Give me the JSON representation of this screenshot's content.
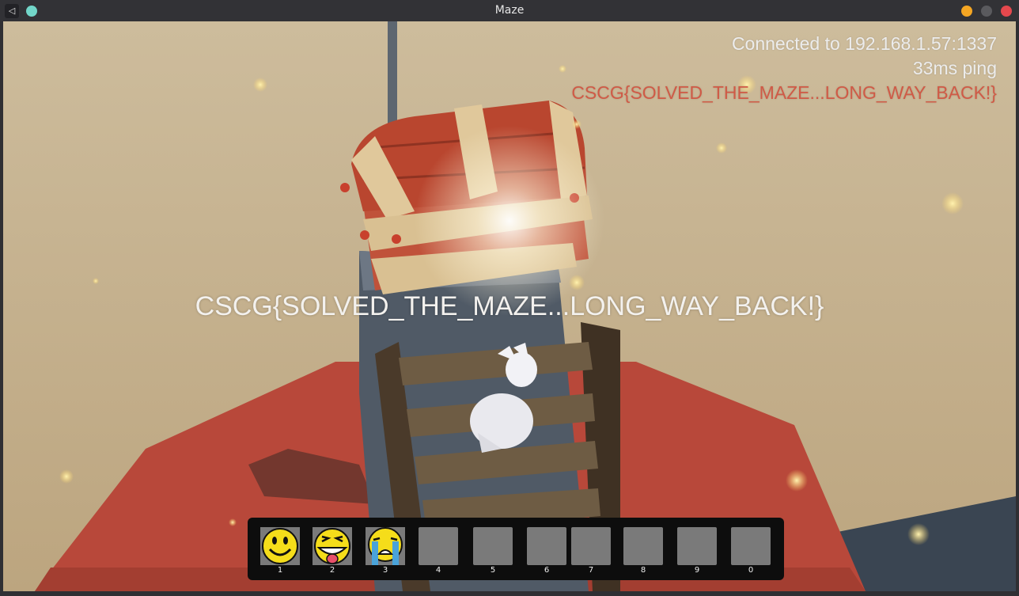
{
  "window": {
    "title": "Maze",
    "controls": {
      "minimize_color": "#f5a623",
      "maximize_color": "#5a5a5e",
      "close_color": "#e5484d"
    }
  },
  "hud": {
    "connection": "Connected to 192.168.1.57:1337",
    "ping": "33ms ping",
    "flag": "CSCG{SOLVED_THE_MAZE...LONG_WAY_BACK!}"
  },
  "center_message": "CSCG{SOLVED_THE_MAZE...LONG_WAY_BACK!}",
  "hotbar": {
    "slots": [
      {
        "key": "1",
        "item": "smile-emoji"
      },
      {
        "key": "2",
        "item": "tongue-emoji"
      },
      {
        "key": "3",
        "item": "crying-emoji"
      },
      {
        "key": "4",
        "item": ""
      },
      {
        "key": "5",
        "item": ""
      },
      {
        "key": "6",
        "item": ""
      },
      {
        "key": "7",
        "item": ""
      },
      {
        "key": "8",
        "item": ""
      },
      {
        "key": "9",
        "item": ""
      },
      {
        "key": "0",
        "item": ""
      }
    ]
  },
  "colors": {
    "flag_red": "#d05a46",
    "sand": "#c9b694",
    "chest_red": "#c0523a",
    "platform_red": "#b8483a"
  }
}
